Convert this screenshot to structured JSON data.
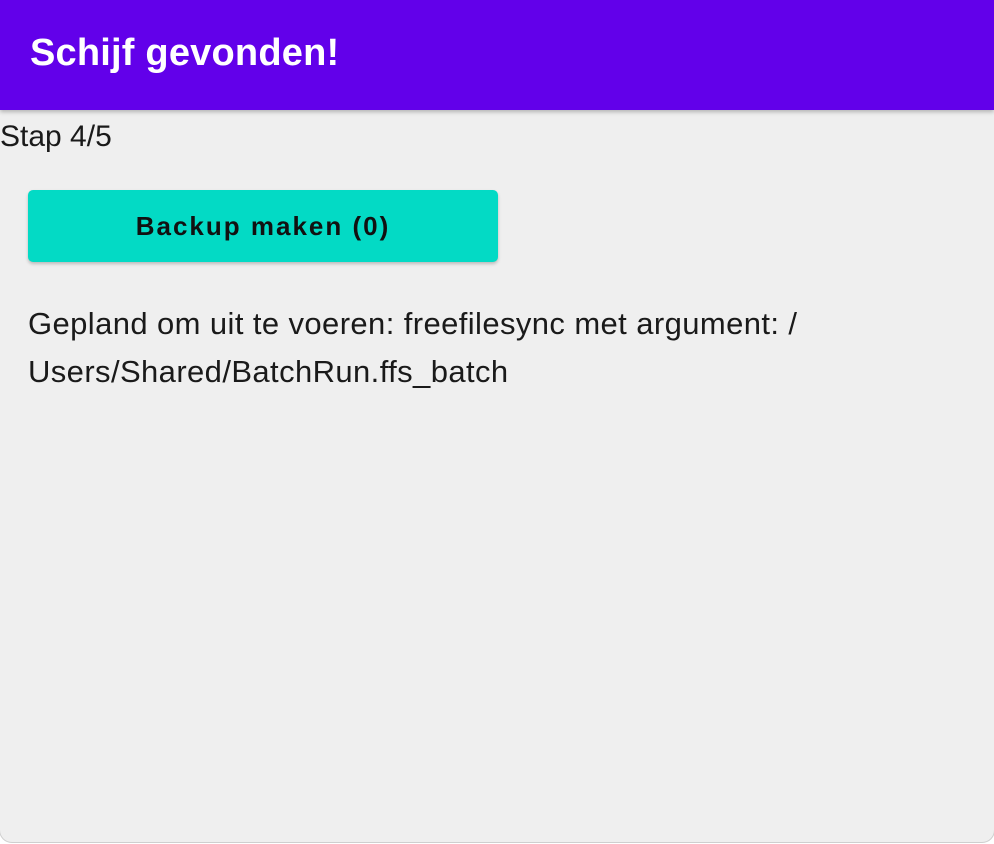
{
  "appbar": {
    "title": "Schijf gevonden!",
    "background_color": "#6200ea"
  },
  "content": {
    "step_label": "Stap 4/5",
    "backup_button_label": "Backup maken (0)",
    "backup_button_color": "#03dac5",
    "scheduled_text_line1": "Gepland om uit te voeren: freefilesync met argument: /",
    "scheduled_text_line2": "Users/Shared/BatchRun.ffs_batch"
  }
}
